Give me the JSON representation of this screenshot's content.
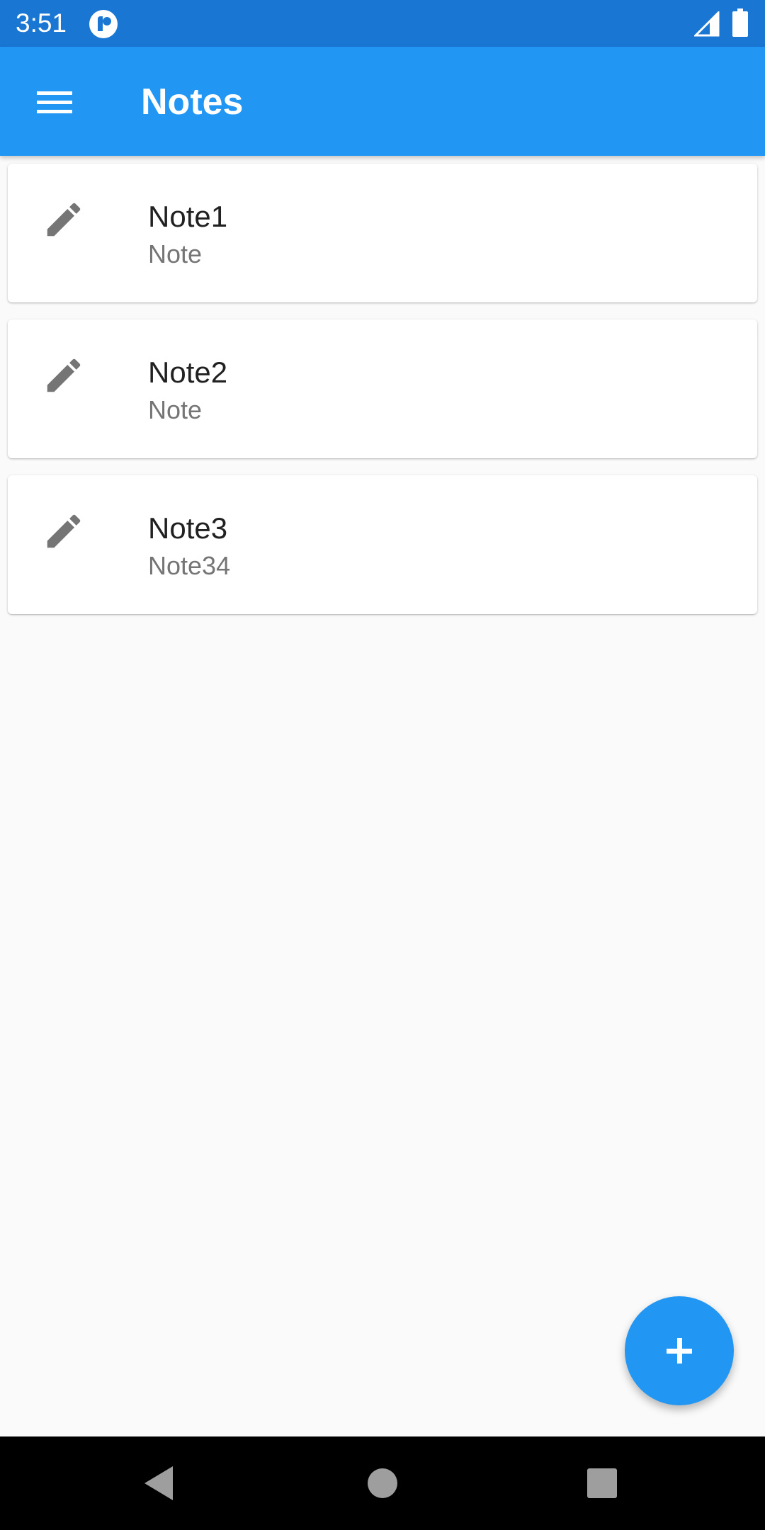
{
  "status_bar": {
    "time": "3:51",
    "app_icon": "pocket-casts-icon",
    "signal_icon": "cell-signal-icon",
    "battery_icon": "battery-icon"
  },
  "app_bar": {
    "menu_icon": "menu-icon",
    "title": "Notes",
    "color": "#2196f3"
  },
  "notes": [
    {
      "title": "Note1",
      "subtitle": "Note",
      "icon": "pencil-icon"
    },
    {
      "title": "Note2",
      "subtitle": "Note",
      "icon": "pencil-icon"
    },
    {
      "title": "Note3",
      "subtitle": "Note34",
      "icon": "pencil-icon"
    }
  ],
  "fab": {
    "icon": "plus-icon",
    "color": "#2196f3"
  },
  "nav_bar": {
    "back_icon": "back-triangle-icon",
    "home_icon": "home-circle-icon",
    "recents_icon": "recents-square-icon"
  },
  "colors": {
    "status_bar": "#1976d2",
    "background": "#fafafa",
    "icon_gray": "#757575"
  }
}
